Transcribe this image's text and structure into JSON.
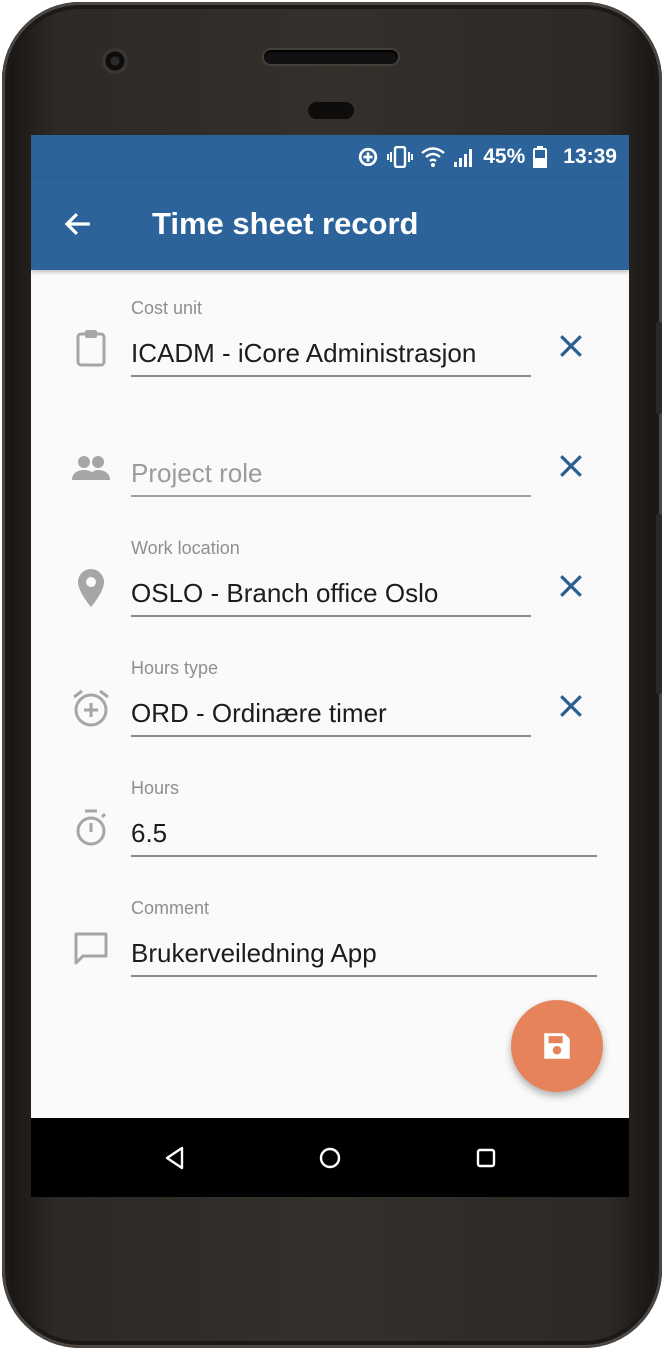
{
  "status_bar": {
    "battery_percent": "45%",
    "time": "13:39",
    "icons": [
      "data-saver-icon",
      "vibrate-icon",
      "wifi-icon",
      "signal-icon",
      "battery-icon"
    ]
  },
  "app_bar": {
    "title": "Time sheet record",
    "back_icon": "arrow-left-icon"
  },
  "form": {
    "cost_unit": {
      "label": "Cost unit",
      "value": "ICADM - iCore Administrasjon",
      "icon": "clipboard-icon"
    },
    "project_role": {
      "placeholder": "Project role",
      "value": "",
      "icon": "people-icon"
    },
    "work_location": {
      "label": "Work location",
      "value": "OSLO - Branch office Oslo",
      "icon": "location-pin-icon"
    },
    "hours_type": {
      "label": "Hours type",
      "value": "ORD - Ordinære timer",
      "icon": "alarm-add-icon"
    },
    "hours": {
      "label": "Hours",
      "value": "6.5",
      "icon": "stopwatch-icon"
    },
    "comment": {
      "label": "Comment",
      "value": "Brukerveiledning App",
      "icon": "comment-icon"
    }
  },
  "fab": {
    "icon": "save-icon"
  },
  "nav_bar": {
    "icons": [
      "nav-back-icon",
      "nav-home-icon",
      "nav-recents-icon"
    ]
  },
  "colors": {
    "primary": "#2b639a",
    "accent": "#e6835a",
    "clear_icon": "#2b5f8f",
    "background": "#fafafa"
  }
}
